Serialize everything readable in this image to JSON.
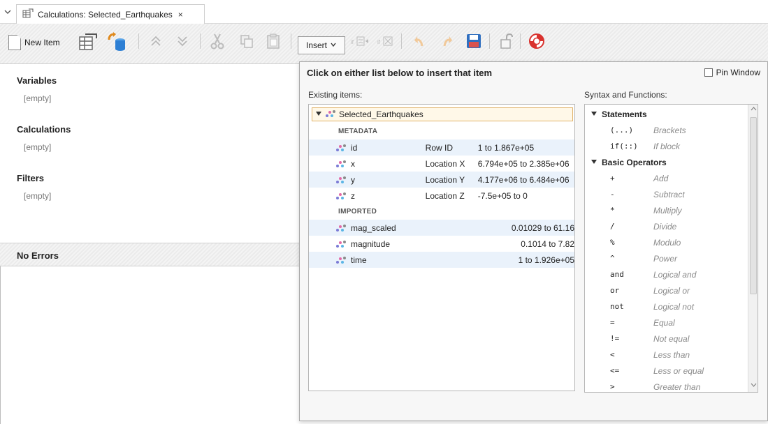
{
  "tab": {
    "title": "Calculations: Selected_Earthquakes",
    "close": "×",
    "menu_glyph": "⌄"
  },
  "toolbar": {
    "new_item": "New Item",
    "insert": "Insert",
    "insert_arrow": "⌄"
  },
  "left": {
    "variables_title": "Variables",
    "variables_value": "[empty]",
    "calculations_title": "Calculations",
    "calculations_value": "[empty]",
    "filters_title": "Filters",
    "filters_value": "[empty]",
    "errors_title": "No Errors"
  },
  "popup": {
    "heading": "Click on either list below to insert that item",
    "pin_label": "Pin Window",
    "existing_label": "Existing items:",
    "syntax_label": "Syntax and Functions:",
    "root_item": "Selected_Earthquakes",
    "groups": [
      "METADATA",
      "IMPORTED"
    ],
    "items": [
      {
        "name": "id",
        "type": "Row ID",
        "range": "1 to 1.867e+05"
      },
      {
        "name": "x",
        "type": "Location X",
        "range": "6.794e+05 to 2.385e+06"
      },
      {
        "name": "y",
        "type": "Location Y",
        "range": "4.177e+06 to 6.484e+06"
      },
      {
        "name": "z",
        "type": "Location Z",
        "range": "-7.5e+05 to 0"
      },
      {
        "name": "mag_scaled",
        "type": "",
        "range": "0.01029 to 61.16"
      },
      {
        "name": "magnitude",
        "type": "",
        "range": "0.1014 to 7.82"
      },
      {
        "name": "time",
        "type": "",
        "range": "1 to 1.926e+05"
      }
    ],
    "syntax": {
      "statements_title": "Statements",
      "statements": [
        {
          "sym": "(...)",
          "desc": "Brackets"
        },
        {
          "sym": "if(::)",
          "desc": "If block"
        }
      ],
      "operators_title": "Basic Operators",
      "operators": [
        {
          "sym": "+",
          "desc": "Add"
        },
        {
          "sym": "-",
          "desc": "Subtract"
        },
        {
          "sym": "*",
          "desc": "Multiply"
        },
        {
          "sym": "/",
          "desc": "Divide"
        },
        {
          "sym": "%",
          "desc": "Modulo"
        },
        {
          "sym": "^",
          "desc": "Power"
        },
        {
          "sym": "and",
          "desc": "Logical and"
        },
        {
          "sym": "or",
          "desc": "Logical or"
        },
        {
          "sym": "not",
          "desc": "Logical not"
        },
        {
          "sym": "=",
          "desc": "Equal"
        },
        {
          "sym": "!=",
          "desc": "Not equal"
        },
        {
          "sym": "<",
          "desc": "Less than"
        },
        {
          "sym": "<=",
          "desc": "Less or equal"
        },
        {
          "sym": ">",
          "desc": "Greater than"
        }
      ]
    }
  }
}
